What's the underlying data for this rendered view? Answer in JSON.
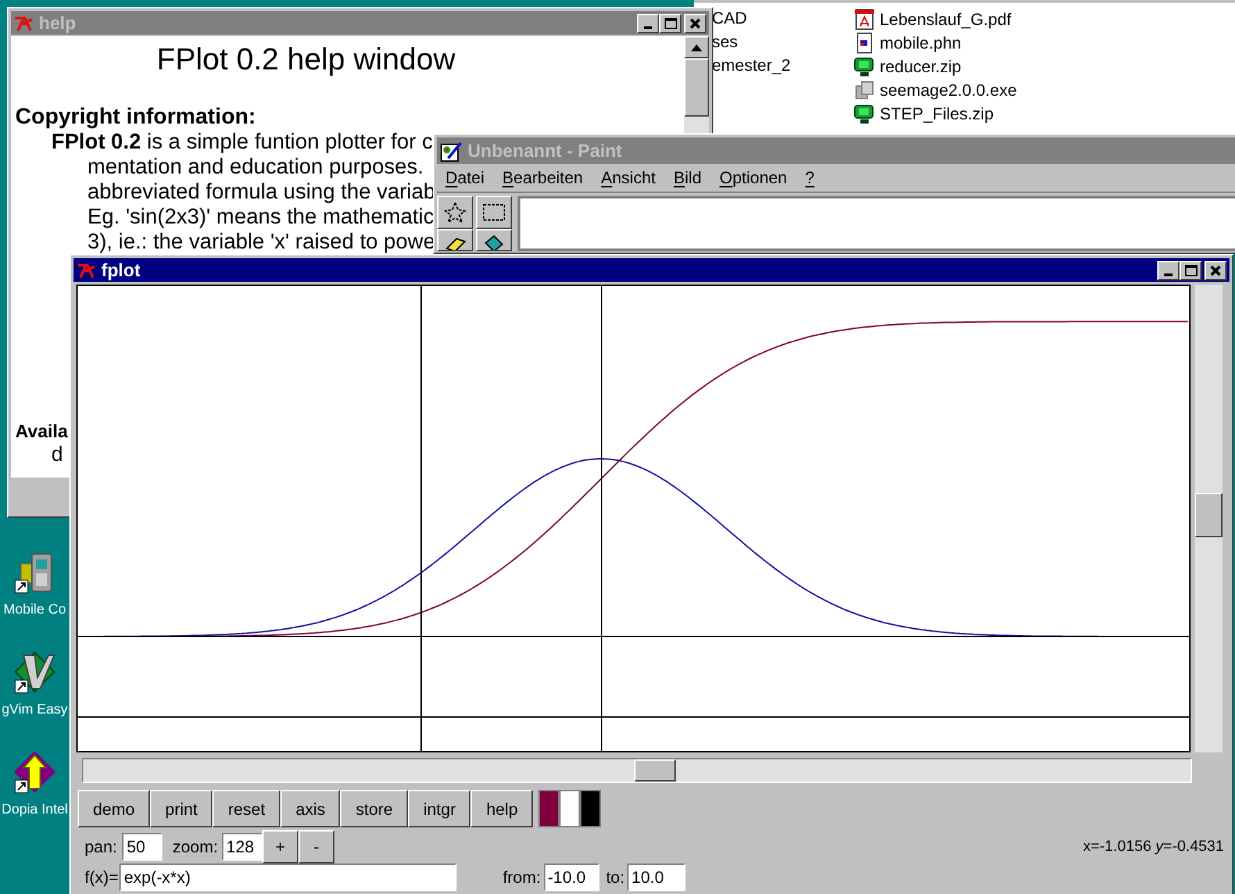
{
  "explorer_window": {
    "column_1": [
      "CAD",
      "ses",
      "emester_2"
    ],
    "files": [
      {
        "name": "Lebenslauf_G.pdf",
        "kind": "pdf"
      },
      {
        "name": "mobile.phn",
        "kind": "doc"
      },
      {
        "name": "reducer.zip",
        "kind": "zip"
      },
      {
        "name": "seemage2.0.0.exe",
        "kind": "exe"
      },
      {
        "name": "STEP_Files.zip",
        "kind": "zip"
      }
    ]
  },
  "help_window": {
    "title": "help",
    "active": false,
    "heading": "FPlot 0.2 help window",
    "section": "Copyright information:",
    "lines": [
      "**FPlot 0.2** is a simple funtion plotter for c",
      "mentation and education purposes.",
      "abbreviated formula using the variab",
      "Eg. 'sin(2x3)' means the mathematic",
      "3), ie.: the variable 'x' raised to powe"
    ],
    "section_2": "Availa",
    "line_2": "d"
  },
  "paint_window": {
    "title": "Unbenannt - Paint",
    "active": false,
    "menu": [
      "Datei",
      "Bearbeiten",
      "Ansicht",
      "Bild",
      "Optionen",
      "?"
    ]
  },
  "desktop_icons": [
    {
      "label": "Mobile Co",
      "kind": "phone"
    },
    {
      "label": "gVim Easy",
      "kind": "vim"
    },
    {
      "label": "Dopia Intel",
      "kind": "setup"
    }
  ],
  "fplot_window": {
    "title": "fplot",
    "active": true,
    "curves": [
      {
        "kind": "function",
        "color": "#1010a0"
      },
      {
        "kind": "integral",
        "color": "#800040"
      }
    ],
    "buttons": [
      "demo",
      "print",
      "reset",
      "axis",
      "store",
      "intgr",
      "help"
    ],
    "swatches": [
      {
        "color": "#800040"
      },
      {
        "color": "#ffffff"
      },
      {
        "color": "#000000"
      }
    ],
    "pan": {
      "label": "pan:",
      "value": "50"
    },
    "zoom": {
      "label": "zoom:",
      "value": "128"
    },
    "zoom_buttons": [
      "+",
      "-"
    ],
    "coordinates": "x=-1.0156 *y*=-0.4531",
    "function": {
      "label": "f(x)=",
      "value": "exp(-x*x)"
    },
    "from": {
      "label": "from:",
      "value": "-10.0"
    },
    "to": {
      "label": "to:",
      "value": "10.0"
    }
  }
}
